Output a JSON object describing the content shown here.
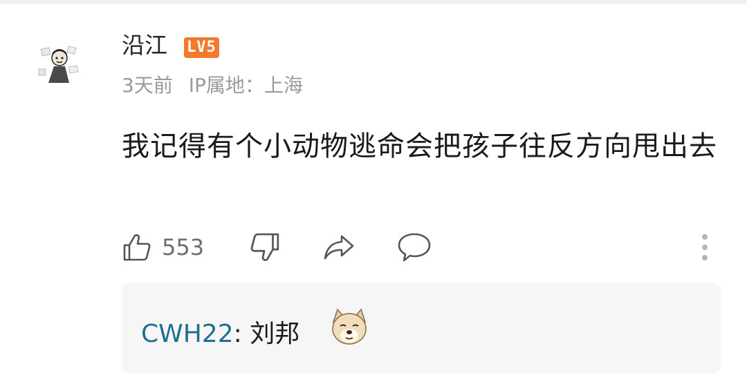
{
  "comment": {
    "username": "沿江",
    "level_badge": "LV5",
    "time": "3天前",
    "ip_location": "IP属地：上海",
    "text": "我记得有个小动物逃命会把孩子往反方向甩出去"
  },
  "actions": {
    "like_count": "553"
  },
  "reply": {
    "username": "CWH22",
    "separator": ":",
    "text": "刘邦",
    "emoji": "dog-face-emoji"
  },
  "icons": {
    "like": "thumbs-up-icon",
    "dislike": "thumbs-down-icon",
    "share": "share-icon",
    "reply": "comment-bubble-icon",
    "more": "more-vertical-icon"
  },
  "colors": {
    "badge": "#f37a2c",
    "reply_username": "#1f6f8f",
    "meta_text": "#9a9a9a",
    "reply_bg": "#f6f6f6"
  }
}
